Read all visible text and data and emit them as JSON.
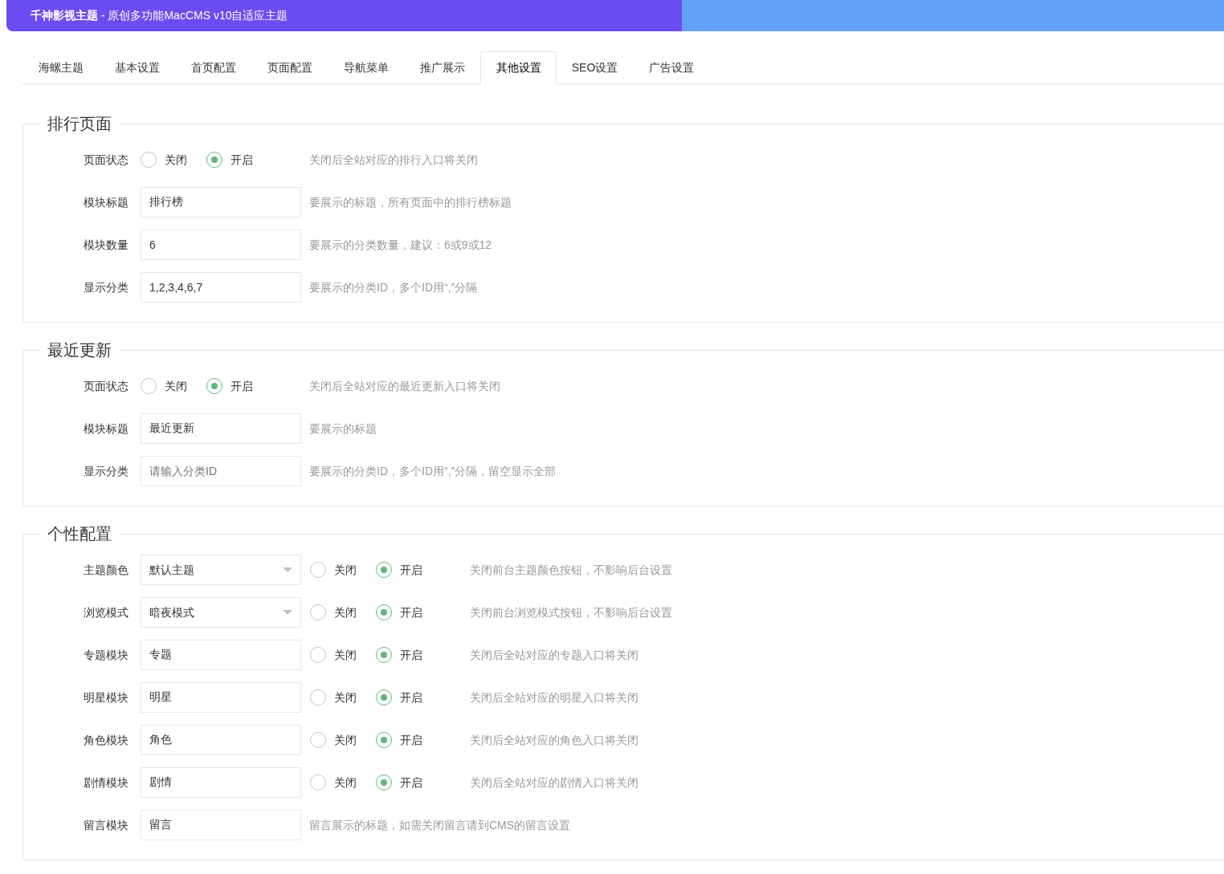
{
  "header": {
    "title": "**千神影视主题** - 原创多功能MacCMS v10自适应主题"
  },
  "tabs": [
    {
      "label": "海螺主题",
      "selected": false
    },
    {
      "label": "基本设置",
      "selected": false
    },
    {
      "label": "首页配置",
      "selected": false
    },
    {
      "label": "页面配置",
      "selected": false
    },
    {
      "label": "导航菜单",
      "selected": false
    },
    {
      "label": "推广展示",
      "selected": false
    },
    {
      "label": "其他设置",
      "selected": true
    },
    {
      "label": "SEO设置",
      "selected": false
    },
    {
      "label": "广告设置",
      "selected": false
    }
  ],
  "sections": [
    {
      "title": "排行页面",
      "rows": [
        {
          "kind": "radio",
          "label": "页面状态",
          "options": [
            {
              "label": "关闭",
              "selected": false
            },
            {
              "label": "开启",
              "selected": true
            }
          ],
          "hint": "关闭后全站对应的排行入口将关闭"
        },
        {
          "kind": "input",
          "label": "模块标题",
          "value": "排行榜",
          "hint": "要展示的标题，所有页面中的排行榜标题"
        },
        {
          "kind": "input",
          "label": "模块数量",
          "value": "6",
          "hint": "要展示的分类数量，建议：6或9或12"
        },
        {
          "kind": "input",
          "label": "显示分类",
          "value": "1,2,3,4,6,7",
          "hint": "要展示的分类ID，多个ID用“,”分隔"
        }
      ]
    },
    {
      "title": "最近更新",
      "rows": [
        {
          "kind": "radio",
          "label": "页面状态",
          "options": [
            {
              "label": "关闭",
              "selected": false
            },
            {
              "label": "开启",
              "selected": true
            }
          ],
          "hint": "关闭后全站对应的最近更新入口将关闭"
        },
        {
          "kind": "input",
          "label": "模块标题",
          "value": "最近更新",
          "hint": "要展示的标题"
        },
        {
          "kind": "input",
          "label": "显示分类",
          "placeholder": "请输入分类ID",
          "hint": "要展示的分类ID，多个ID用“,”分隔，留空显示全部"
        }
      ]
    },
    {
      "title": "个性配置",
      "rows": [
        {
          "kind": "select",
          "label": "主题颜色",
          "value": "默认主题",
          "options": [
            {
              "label": "关闭",
              "selected": false
            },
            {
              "label": "开启",
              "selected": true
            }
          ],
          "hint": "关闭前台主题颜色按钮，不影响后台设置"
        },
        {
          "kind": "select",
          "label": "浏览模式",
          "value": "暗夜模式",
          "options": [
            {
              "label": "关闭",
              "selected": false
            },
            {
              "label": "开启",
              "selected": true
            }
          ],
          "hint": "关闭前台浏览模式按钮，不影响后台设置"
        },
        {
          "kind": "input",
          "label": "专题模块",
          "value": "专题",
          "options": [
            {
              "label": "关闭",
              "selected": false
            },
            {
              "label": "开启",
              "selected": true
            }
          ],
          "hint": "关闭后全站对应的专题入口将关闭"
        },
        {
          "kind": "input",
          "label": "明星模块",
          "value": "明星",
          "options": [
            {
              "label": "关闭",
              "selected": false
            },
            {
              "label": "开启",
              "selected": true
            }
          ],
          "hint": "关闭后全站对应的明星入口将关闭"
        },
        {
          "kind": "input",
          "label": "角色模块",
          "value": "角色",
          "options": [
            {
              "label": "关闭",
              "selected": false
            },
            {
              "label": "开启",
              "selected": true
            }
          ],
          "hint": "关闭后全站对应的角色入口将关闭"
        },
        {
          "kind": "input",
          "label": "剧情模块",
          "value": "剧情",
          "options": [
            {
              "label": "关闭",
              "selected": false
            },
            {
              "label": "开启",
              "selected": true
            }
          ],
          "hint": "关闭后全站对应的剧情入口将关闭"
        },
        {
          "kind": "input",
          "label": "留言模块",
          "value": "留言",
          "hint": "留言展示的标题，如需关闭留言请到CMS的留言设置"
        }
      ]
    }
  ]
}
